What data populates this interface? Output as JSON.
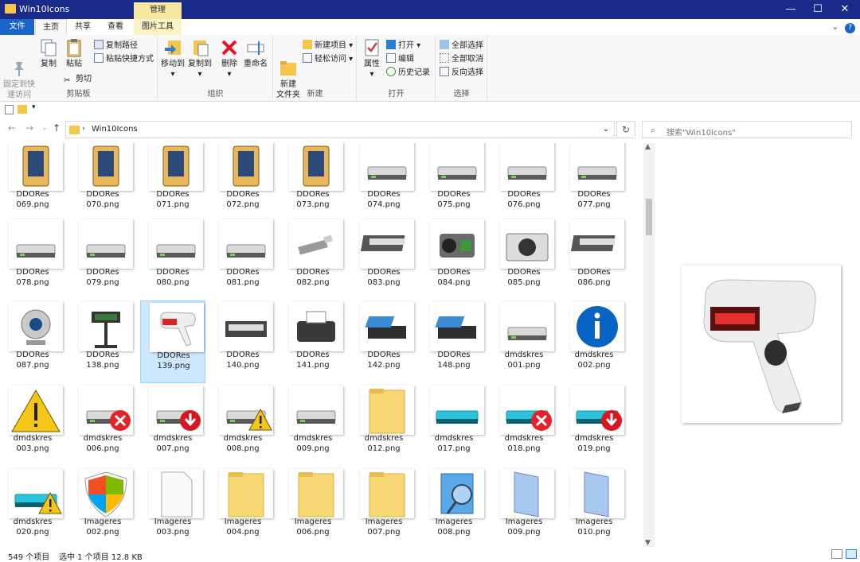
{
  "window": {
    "title": "Win10Icons",
    "manage_tab": "管理",
    "minimize": "—",
    "maximize": "☐",
    "close": "✕"
  },
  "ribbon_tabs": [
    "文件",
    "主页",
    "共享",
    "查看",
    "图片工具"
  ],
  "ribbon": {
    "clipboard": {
      "pin": "固定到快\n速访问",
      "copy": "复制",
      "paste": "粘贴",
      "copy_path": "复制路径",
      "paste_shortcut": "粘贴快捷方式",
      "cut": "剪切",
      "label": "剪贴板"
    },
    "organize": {
      "move_to": "移动到",
      "copy_to": "复制到",
      "delete": "删除",
      "rename": "重命名",
      "label": "组织"
    },
    "new": {
      "new_folder": "新建\n文件夹",
      "new_item": "新建项目",
      "easy_access": "轻松访问",
      "label": "新建"
    },
    "open": {
      "properties": "属性",
      "open": "打开",
      "edit": "编辑",
      "history": "历史记录",
      "label": "打开"
    },
    "select": {
      "select_all": "全部选择",
      "select_none": "全部取消",
      "invert": "反向选择",
      "label": "选择"
    }
  },
  "address": {
    "path": "Win10Icons",
    "search_placeholder": "搜索\"Win10Icons\""
  },
  "files": [
    {
      "l1": "DDORes",
      "l2": "069.png",
      "icon": "device-card-icon"
    },
    {
      "l1": "DDORes",
      "l2": "070.png",
      "icon": "device-card-icon"
    },
    {
      "l1": "DDORes",
      "l2": "071.png",
      "icon": "device-card-icon"
    },
    {
      "l1": "DDORes",
      "l2": "072.png",
      "icon": "device-card-icon"
    },
    {
      "l1": "DDORes",
      "l2": "073.png",
      "icon": "device-card-icon"
    },
    {
      "l1": "DDORes",
      "l2": "074.png",
      "icon": "drive-icon"
    },
    {
      "l1": "DDORes",
      "l2": "075.png",
      "icon": "drive-icon"
    },
    {
      "l1": "DDORes",
      "l2": "076.png",
      "icon": "drive-icon"
    },
    {
      "l1": "DDORes",
      "l2": "077.png",
      "icon": "drive-icon"
    },
    {
      "l1": "DDORes",
      "l2": "078.png",
      "icon": "drive-icon"
    },
    {
      "l1": "DDORes",
      "l2": "079.png",
      "icon": "drive-icon"
    },
    {
      "l1": "DDORes",
      "l2": "080.png",
      "icon": "drive-icon"
    },
    {
      "l1": "DDORes",
      "l2": "081.png",
      "icon": "drive-icon"
    },
    {
      "l1": "DDORes",
      "l2": "082.png",
      "icon": "usb-icon"
    },
    {
      "l1": "DDORes",
      "l2": "083.png",
      "icon": "scanner-icon"
    },
    {
      "l1": "DDORes",
      "l2": "084.png",
      "icon": "camcorder-icon"
    },
    {
      "l1": "DDORes",
      "l2": "085.png",
      "icon": "camera-icon"
    },
    {
      "l1": "DDORes",
      "l2": "086.png",
      "icon": "scanner-icon"
    },
    {
      "l1": "DDORes",
      "l2": "087.png",
      "icon": "webcam-icon"
    },
    {
      "l1": "DDORes",
      "l2": "138.png",
      "icon": "pole-display-icon"
    },
    {
      "l1": "DDORes",
      "l2": "139.png",
      "icon": "barcode-scanner-icon"
    },
    {
      "l1": "DDORes",
      "l2": "140.png",
      "icon": "cash-drawer-icon"
    },
    {
      "l1": "DDORes",
      "l2": "141.png",
      "icon": "receipt-printer-icon"
    },
    {
      "l1": "DDORes",
      "l2": "142.png",
      "icon": "card-reader-icon"
    },
    {
      "l1": "DDORes",
      "l2": "148.png",
      "icon": "card-reader-icon"
    },
    {
      "l1": "dmdskres",
      "l2": "001.png",
      "icon": "drive-icon"
    },
    {
      "l1": "dmdskres",
      "l2": "002.png",
      "icon": "info-icon"
    },
    {
      "l1": "dmdskres",
      "l2": "003.png",
      "icon": "warning-icon"
    },
    {
      "l1": "dmdskres",
      "l2": "006.png",
      "icon": "drive-error-icon"
    },
    {
      "l1": "dmdskres",
      "l2": "007.png",
      "icon": "drive-download-icon"
    },
    {
      "l1": "dmdskres",
      "l2": "008.png",
      "icon": "drive-warning-icon"
    },
    {
      "l1": "dmdskres",
      "l2": "009.png",
      "icon": "drive-icon"
    },
    {
      "l1": "dmdskres",
      "l2": "012.png",
      "icon": "folder-icon"
    },
    {
      "l1": "dmdskres",
      "l2": "017.png",
      "icon": "cyan-drive-icon"
    },
    {
      "l1": "dmdskres",
      "l2": "018.png",
      "icon": "cyan-drive-error-icon"
    },
    {
      "l1": "dmdskres",
      "l2": "019.png",
      "icon": "cyan-drive-download-icon"
    },
    {
      "l1": "dmdskres",
      "l2": "020.png",
      "icon": "cyan-drive-warning-icon"
    },
    {
      "l1": "Imageres",
      "l2": "002.png",
      "icon": "shield-icon"
    },
    {
      "l1": "Imageres",
      "l2": "003.png",
      "icon": "document-icon"
    },
    {
      "l1": "Imageres",
      "l2": "004.png",
      "icon": "folder-icon"
    },
    {
      "l1": "Imageres",
      "l2": "006.png",
      "icon": "folder-icon"
    },
    {
      "l1": "Imageres",
      "l2": "007.png",
      "icon": "folder-icon"
    },
    {
      "l1": "Imageres",
      "l2": "008.png",
      "icon": "search-files-icon"
    },
    {
      "l1": "Imageres",
      "l2": "009.png",
      "icon": "glass-pane-icon"
    },
    {
      "l1": "Imageres",
      "l2": "010.png",
      "icon": "glass-pane-icon"
    }
  ],
  "selected_index": 20,
  "status": {
    "count": "549 个项目",
    "selected": "选中 1 个项目  12.8 KB"
  },
  "colors": {
    "titlebar": "#1a2b8a",
    "file_tab": "#1a64c8",
    "selection": "#cce8ff"
  }
}
